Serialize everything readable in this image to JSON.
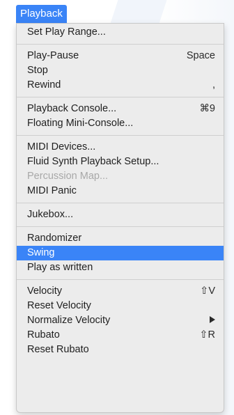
{
  "menu": {
    "title": "Playback",
    "groups": [
      [
        {
          "label": "Set Play Range..."
        }
      ],
      [
        {
          "label": "Play-Pause",
          "shortcut": "Space"
        },
        {
          "label": "Stop"
        },
        {
          "label": "Rewind",
          "shortcut": ","
        }
      ],
      [
        {
          "label": "Playback Console...",
          "shortcut": "⌘9"
        },
        {
          "label": "Floating Mini-Console..."
        }
      ],
      [
        {
          "label": "MIDI Devices..."
        },
        {
          "label": "Fluid Synth Playback Setup..."
        },
        {
          "label": "Percussion Map...",
          "disabled": true
        },
        {
          "label": "MIDI Panic"
        }
      ],
      [
        {
          "label": "Jukebox..."
        }
      ],
      [
        {
          "label": "Randomizer"
        },
        {
          "label": "Swing",
          "selected": true
        },
        {
          "label": "Play as written"
        }
      ],
      [
        {
          "label": "Velocity",
          "shortcut": "⇧V"
        },
        {
          "label": "Reset Velocity"
        },
        {
          "label": "Normalize Velocity",
          "submenu_icon": "submenu-arrow-icon"
        },
        {
          "label": "Rubato",
          "shortcut": "⇧R"
        },
        {
          "label": "Reset Rubato"
        }
      ]
    ]
  },
  "colors": {
    "highlight": "#3a84f7",
    "menu_bg": "#ececec",
    "disabled_text": "#a8a8a8"
  }
}
